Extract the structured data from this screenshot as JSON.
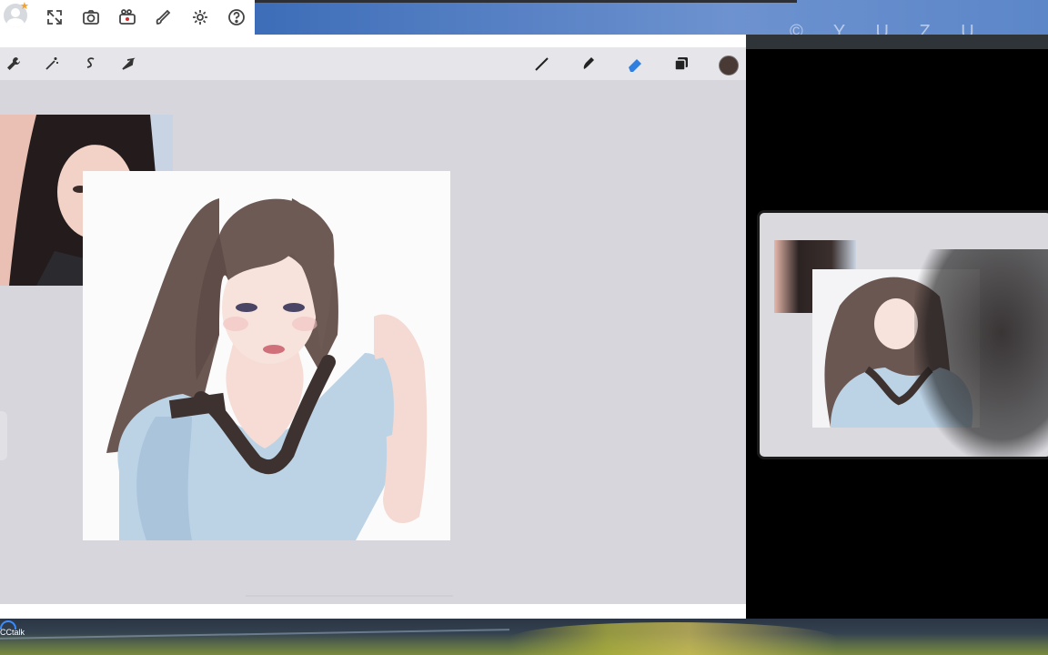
{
  "desktop": {
    "watermark": "© Y U Z U",
    "taskbar_app": "CCtalk"
  },
  "appbar": {
    "icons": [
      "avatar-icon",
      "expand-icon",
      "camera-icon",
      "video-camera-icon",
      "brush-pen-icon",
      "gear-icon",
      "help-icon"
    ]
  },
  "procreate": {
    "left_tools": [
      "wrench-icon",
      "magic-wand-icon",
      "selection-s-icon",
      "transform-arrow-icon"
    ],
    "right_tools": [
      "brush-icon",
      "smudge-icon",
      "eraser-icon",
      "layers-icon"
    ],
    "active_tool": "eraser-icon",
    "current_color": "#4a3a36",
    "accent": "#2f7fe0"
  }
}
